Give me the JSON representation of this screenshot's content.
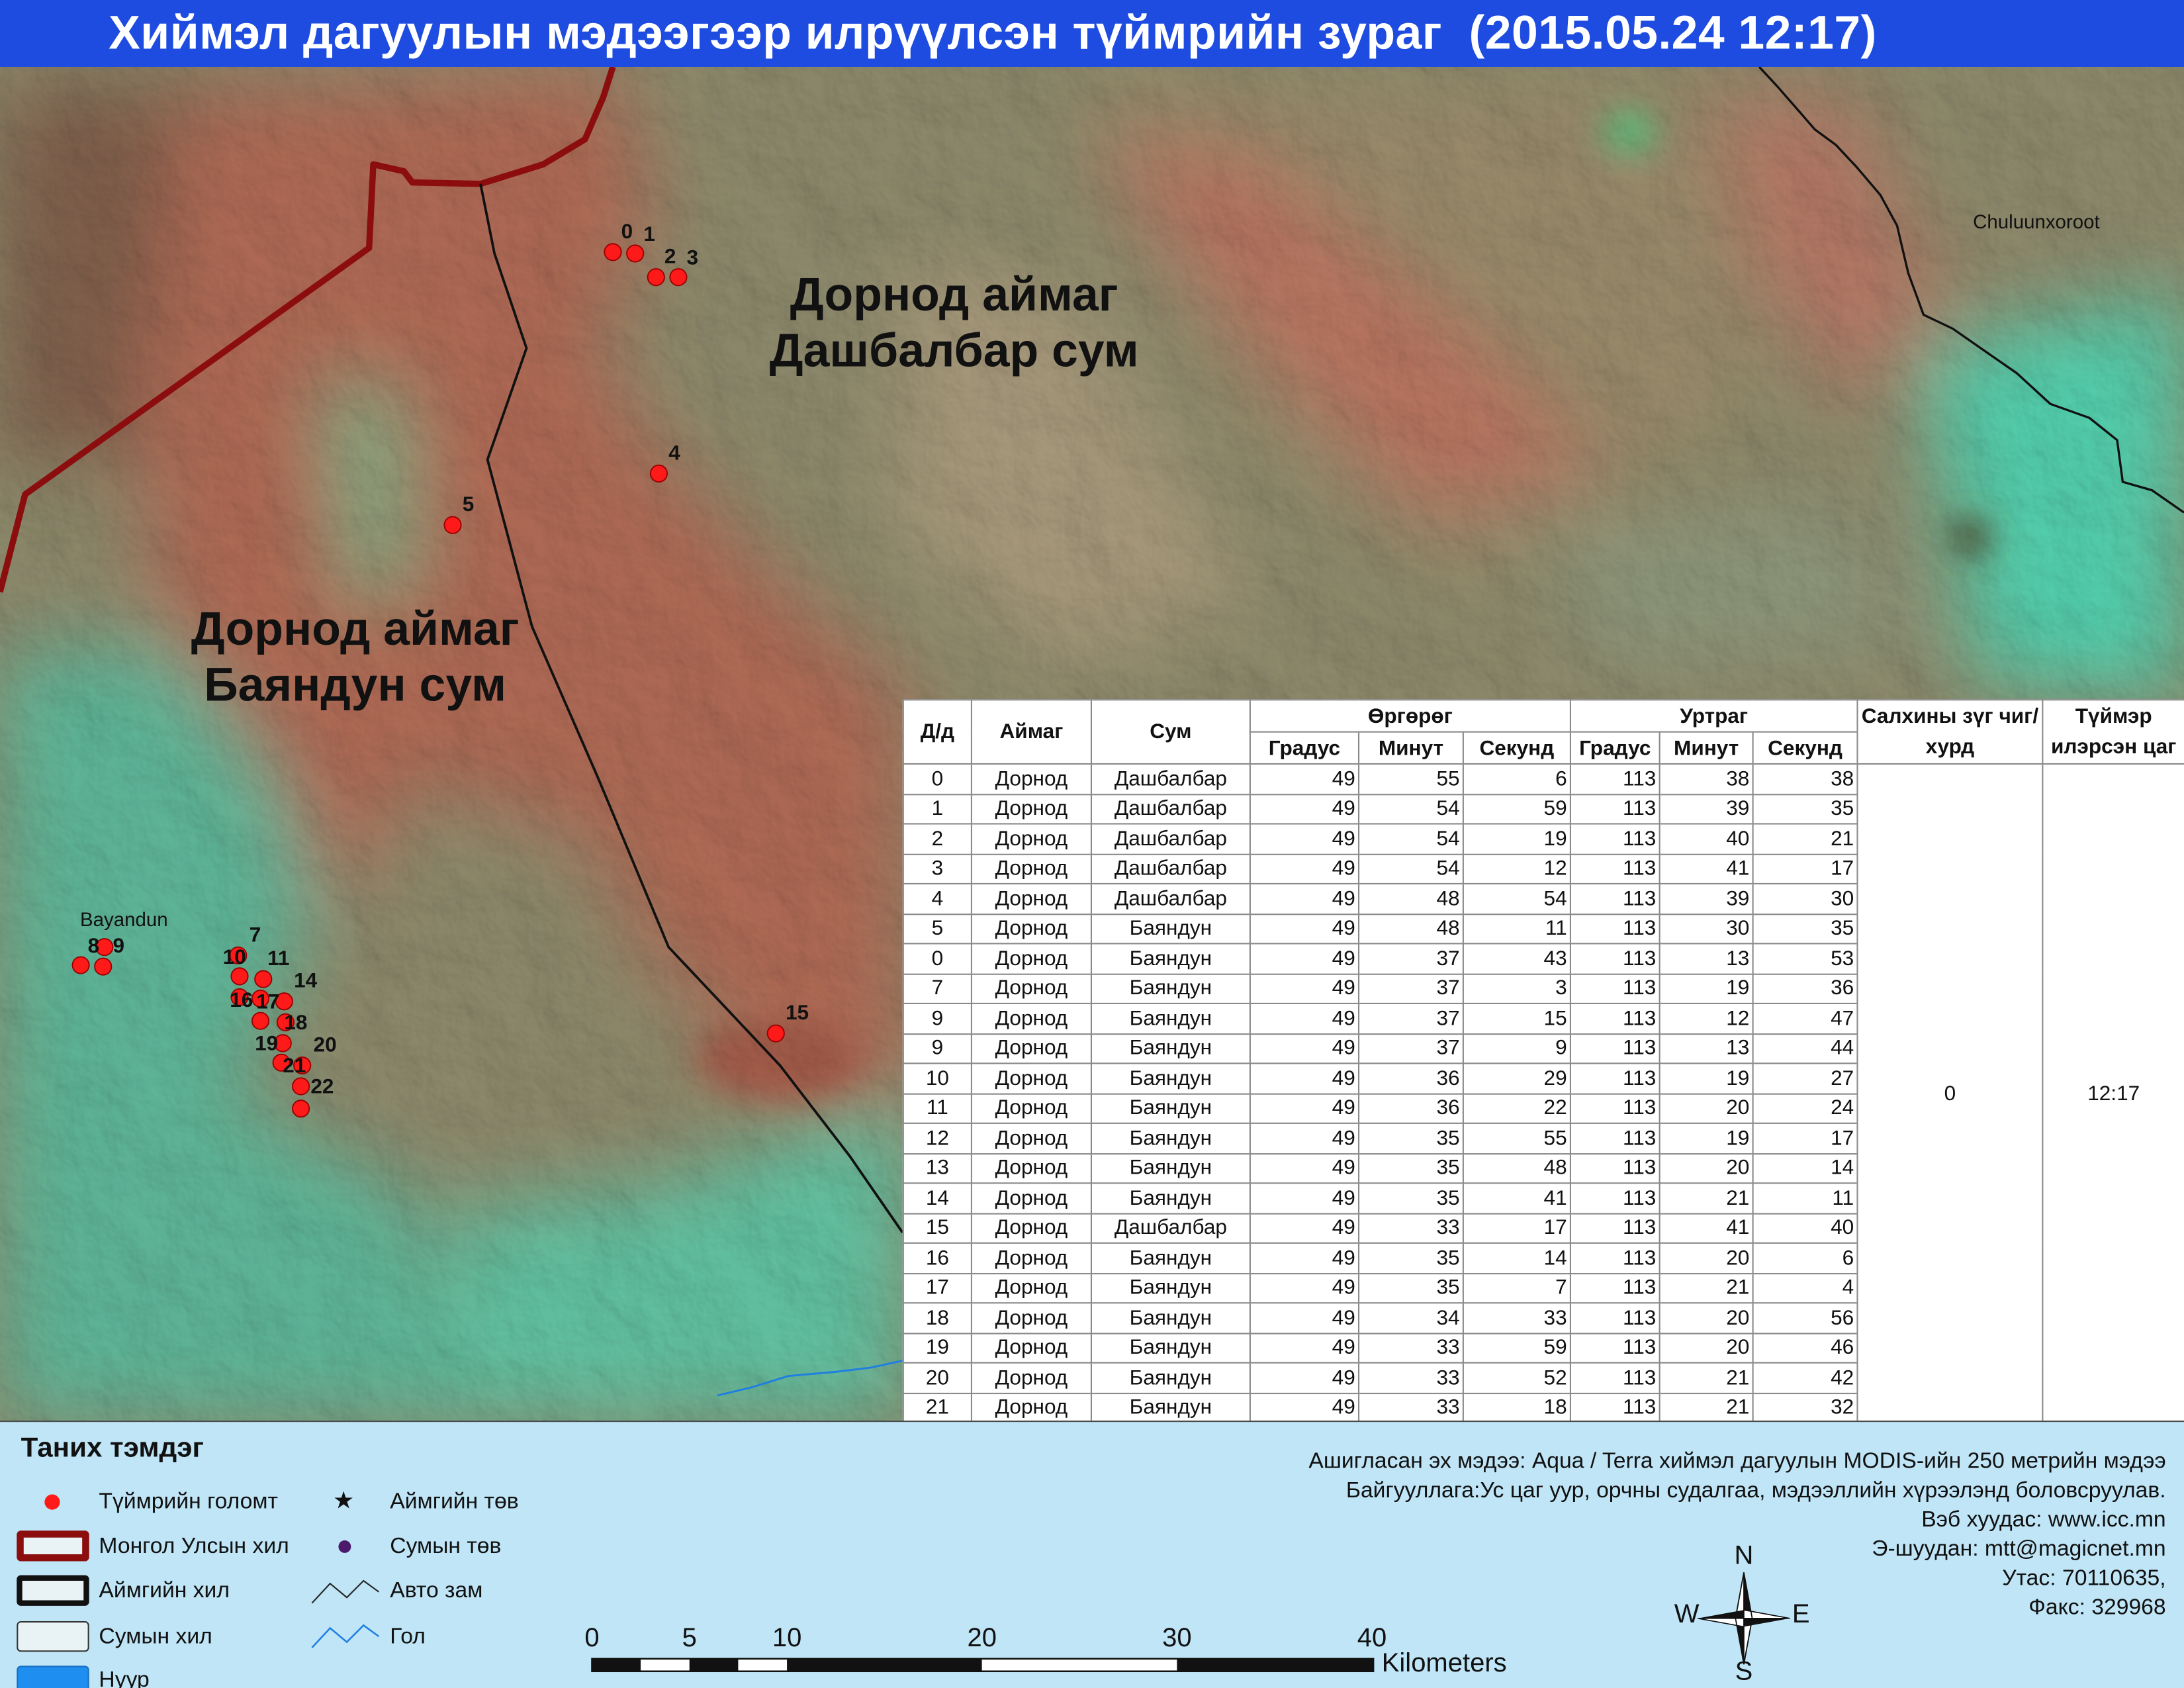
{
  "title": "Хиймэл дагуулын мэдээгээр илрүүлсэн түймрийн зураг  (2015.05.24 12:17)",
  "colors": {
    "title_bar": "#1f4ce0",
    "fire_point": "#ff1a1a",
    "national_border": "#8b0d0d",
    "legend_background": "#bfe5f7"
  },
  "map": {
    "regions": [
      {
        "line1": "Дорнод аймаг",
        "line2": "Дашбалбар сум"
      },
      {
        "line1": "Дорнод аймаг",
        "line2": "Баяндун  сум"
      }
    ],
    "places": [
      "Chuluunxoroot",
      "Bayandun"
    ],
    "fire_labels": [
      "0",
      "1",
      "2",
      "3",
      "4",
      "5",
      "7",
      "8",
      "9",
      "10",
      "11",
      "14",
      "16",
      "17",
      "18",
      "19",
      "20",
      "21",
      "22",
      "15"
    ]
  },
  "table": {
    "headers": {
      "no": "Д/д",
      "aimag": "Аймаг",
      "sum": "Сум",
      "latitude": "Өргөрөг",
      "longitude": "Уртраг",
      "wind": "Салхины зүг чиг/хурд",
      "time": "Түймэр илэрсэн цаг",
      "degree": "Градус",
      "minute": "Минут",
      "second": "Секунд"
    },
    "wind_value": "0",
    "time_value": "12:17",
    "rows": [
      {
        "no": "0",
        "aimag": "Дорнод",
        "sum": "Дашбалбар",
        "lat_deg": 49,
        "lat_min": 55,
        "lat_sec": 6,
        "lon_deg": 113,
        "lon_min": 38,
        "lon_sec": 38
      },
      {
        "no": "1",
        "aimag": "Дорнод",
        "sum": "Дашбалбар",
        "lat_deg": 49,
        "lat_min": 54,
        "lat_sec": 59,
        "lon_deg": 113,
        "lon_min": 39,
        "lon_sec": 35
      },
      {
        "no": "2",
        "aimag": "Дорнод",
        "sum": "Дашбалбар",
        "lat_deg": 49,
        "lat_min": 54,
        "lat_sec": 19,
        "lon_deg": 113,
        "lon_min": 40,
        "lon_sec": 21
      },
      {
        "no": "3",
        "aimag": "Дорнод",
        "sum": "Дашбалбар",
        "lat_deg": 49,
        "lat_min": 54,
        "lat_sec": 12,
        "lon_deg": 113,
        "lon_min": 41,
        "lon_sec": 17
      },
      {
        "no": "4",
        "aimag": "Дорнод",
        "sum": "Дашбалбар",
        "lat_deg": 49,
        "lat_min": 48,
        "lat_sec": 54,
        "lon_deg": 113,
        "lon_min": 39,
        "lon_sec": 30
      },
      {
        "no": "5",
        "aimag": "Дорнод",
        "sum": "Баяндун",
        "lat_deg": 49,
        "lat_min": 48,
        "lat_sec": 11,
        "lon_deg": 113,
        "lon_min": 30,
        "lon_sec": 35
      },
      {
        "no": "0",
        "aimag": "Дорнод",
        "sum": "Баяндун",
        "lat_deg": 49,
        "lat_min": 37,
        "lat_sec": 43,
        "lon_deg": 113,
        "lon_min": 13,
        "lon_sec": 53
      },
      {
        "no": "7",
        "aimag": "Дорнод",
        "sum": "Баяндун",
        "lat_deg": 49,
        "lat_min": 37,
        "lat_sec": 3,
        "lon_deg": 113,
        "lon_min": 19,
        "lon_sec": 36
      },
      {
        "no": "9",
        "aimag": "Дорнод",
        "sum": "Баяндун",
        "lat_deg": 49,
        "lat_min": 37,
        "lat_sec": 15,
        "lon_deg": 113,
        "lon_min": 12,
        "lon_sec": 47
      },
      {
        "no": "9",
        "aimag": "Дорнод",
        "sum": "Баяндун",
        "lat_deg": 49,
        "lat_min": 37,
        "lat_sec": 9,
        "lon_deg": 113,
        "lon_min": 13,
        "lon_sec": 44
      },
      {
        "no": "10",
        "aimag": "Дорнод",
        "sum": "Баяндун",
        "lat_deg": 49,
        "lat_min": 36,
        "lat_sec": 29,
        "lon_deg": 113,
        "lon_min": 19,
        "lon_sec": 27
      },
      {
        "no": "11",
        "aimag": "Дорнод",
        "sum": "Баяндун",
        "lat_deg": 49,
        "lat_min": 36,
        "lat_sec": 22,
        "lon_deg": 113,
        "lon_min": 20,
        "lon_sec": 24
      },
      {
        "no": "12",
        "aimag": "Дорнод",
        "sum": "Баяндун",
        "lat_deg": 49,
        "lat_min": 35,
        "lat_sec": 55,
        "lon_deg": 113,
        "lon_min": 19,
        "lon_sec": 17
      },
      {
        "no": "13",
        "aimag": "Дорнод",
        "sum": "Баяндун",
        "lat_deg": 49,
        "lat_min": 35,
        "lat_sec": 48,
        "lon_deg": 113,
        "lon_min": 20,
        "lon_sec": 14
      },
      {
        "no": "14",
        "aimag": "Дорнод",
        "sum": "Баяндун",
        "lat_deg": 49,
        "lat_min": 35,
        "lat_sec": 41,
        "lon_deg": 113,
        "lon_min": 21,
        "lon_sec": 11
      },
      {
        "no": "15",
        "aimag": "Дорнод",
        "sum": "Дашбалбар",
        "lat_deg": 49,
        "lat_min": 33,
        "lat_sec": 17,
        "lon_deg": 113,
        "lon_min": 41,
        "lon_sec": 40
      },
      {
        "no": "16",
        "aimag": "Дорнод",
        "sum": "Баяндун",
        "lat_deg": 49,
        "lat_min": 35,
        "lat_sec": 14,
        "lon_deg": 113,
        "lon_min": 20,
        "lon_sec": 6
      },
      {
        "no": "17",
        "aimag": "Дорнод",
        "sum": "Баяндун",
        "lat_deg": 49,
        "lat_min": 35,
        "lat_sec": 7,
        "lon_deg": 113,
        "lon_min": 21,
        "lon_sec": 4
      },
      {
        "no": "18",
        "aimag": "Дорнод",
        "sum": "Баяндун",
        "lat_deg": 49,
        "lat_min": 34,
        "lat_sec": 33,
        "lon_deg": 113,
        "lon_min": 20,
        "lon_sec": 56
      },
      {
        "no": "19",
        "aimag": "Дорнод",
        "sum": "Баяндун",
        "lat_deg": 49,
        "lat_min": 33,
        "lat_sec": 59,
        "lon_deg": 113,
        "lon_min": 20,
        "lon_sec": 46
      },
      {
        "no": "20",
        "aimag": "Дорнод",
        "sum": "Баяндун",
        "lat_deg": 49,
        "lat_min": 33,
        "lat_sec": 52,
        "lon_deg": 113,
        "lon_min": 21,
        "lon_sec": 42
      },
      {
        "no": "21",
        "aimag": "Дорнод",
        "sum": "Баяндун",
        "lat_deg": 49,
        "lat_min": 33,
        "lat_sec": 18,
        "lon_deg": 113,
        "lon_min": 21,
        "lon_sec": 32
      }
    ]
  },
  "legend": {
    "title": "Таних тэмдэг",
    "fire_point": "Түймрийн голомт",
    "national_border": "Монгол Улсын хил",
    "aimag_border": "Аймгийн хил",
    "sum_border": "Сумын хил",
    "lake": "Нуур",
    "aimag_center": "Аймгийн төв",
    "sum_center": "Сумын төв",
    "road": "Авто зам",
    "river": "Гол",
    "aimag_center_icon": "star-icon",
    "sum_center_icon": "purple-dot-icon"
  },
  "scale_bar": {
    "ticks": [
      "0",
      "5",
      "10",
      "20",
      "30",
      "40"
    ],
    "unit": "Kilometers"
  },
  "compass": {
    "north": "N",
    "south": "S",
    "west": "W",
    "east": "E"
  },
  "source": {
    "line1": "Ашигласан эх мэдээ: Aqua / Terra хиймэл дагуулын MODIS-ийн 250 метрийн мэдээ",
    "line2": "Байгууллага:Ус цаг уур, орчны судалгаа, мэдээллийн хүрээлэнд боловсруулав.",
    "line3": "Вэб хуудас: www.icc.mn",
    "line4": "Э-шуудан: mtt@magicnet.mn",
    "line5": "Утас: 70110635,",
    "line6": "Факс: 329968"
  }
}
